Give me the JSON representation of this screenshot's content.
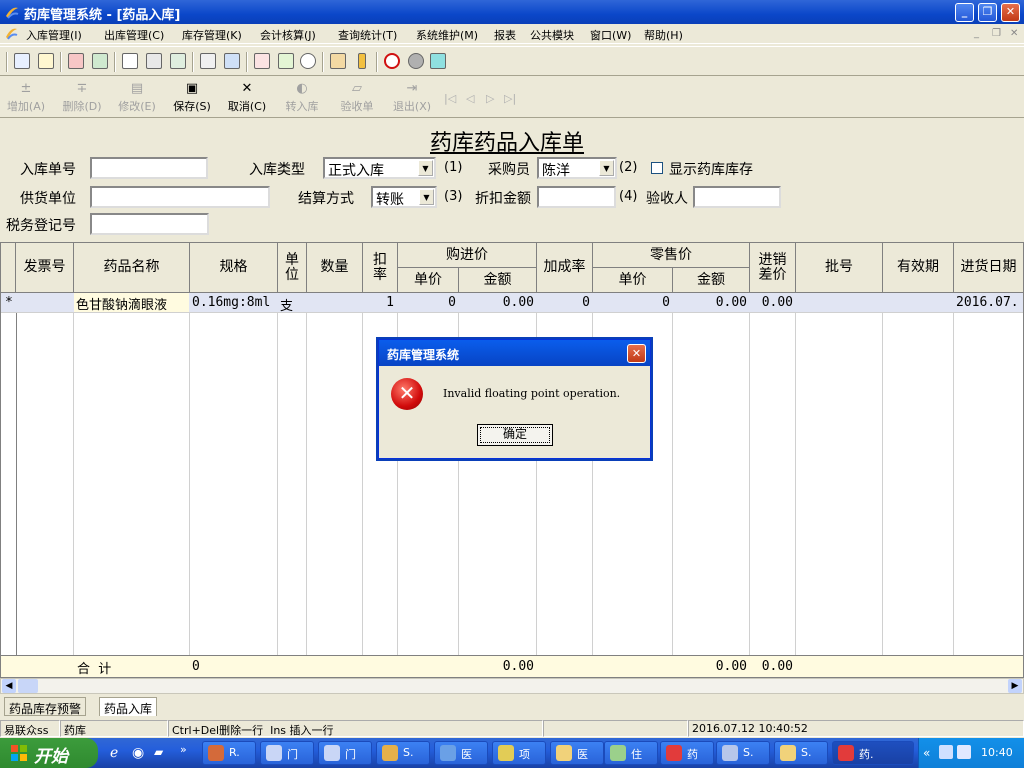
{
  "window": {
    "title": "药库管理系统 - [药品入库]"
  },
  "menu": {
    "items": [
      "入库管理(I)",
      "出库管理(C)",
      "库存管理(K)",
      "会计核算(J)",
      "查询统计(T)",
      "系统维护(M)",
      "报表",
      "公共模块",
      "窗口(W)",
      "帮助(H)"
    ]
  },
  "toolbar2": {
    "add": "增加(A)",
    "delete": "删除(D)",
    "modify": "修改(E)",
    "save": "保存(S)",
    "cancel": "取消(C)",
    "transfer": "转入库",
    "inspect": "验收单",
    "exit": "退出(X)"
  },
  "form": {
    "title": "药库药品入库单",
    "order_no_label": "入库单号",
    "order_no": "",
    "type_label": "入库类型",
    "type_value": "正式入库",
    "type_hint": "(1)",
    "buyer_label": "采购员",
    "buyer_value": "陈洋",
    "buyer_hint": "(2)",
    "show_stock_label": "显示药库库存",
    "supplier_label": "供货单位",
    "supplier": "",
    "settle_label": "结算方式",
    "settle_value": "转账",
    "settle_hint": "(3)",
    "discount_label": "折扣金额",
    "discount": "",
    "discount_hint": "(4)",
    "inspector_label": "验收人",
    "inspector": "",
    "tax_label": "税务登记号",
    "tax": ""
  },
  "grid": {
    "headers": {
      "invoice": "发票号",
      "name": "药品名称",
      "spec": "规格",
      "unit": "单位",
      "qty": "数量",
      "deduct": "扣率",
      "purchase": "购进价",
      "p_unit": "单价",
      "p_amount": "金额",
      "markup": "加成率",
      "retail": "零售价",
      "r_unit": "单价",
      "r_amount": "金额",
      "diff": "进销差价",
      "batch": "批号",
      "expiry": "有效期",
      "date": "进货日期"
    },
    "row": {
      "marker": "*",
      "invoice": "",
      "name": "色甘酸钠滴眼液",
      "spec": "0.16mg:8ml",
      "unit": "支",
      "qty": "",
      "deduct": "1",
      "p_unit": "0",
      "p_amount": "0.00",
      "markup": "0",
      "r_unit": "0",
      "r_amount": "0.00",
      "diff": "0.00",
      "batch": "",
      "expiry": "",
      "date": "2016.07."
    },
    "total": {
      "label": "合  计",
      "spec": "0",
      "p_amount": "0.00",
      "r_amount": "0.00",
      "diff": "0.00"
    }
  },
  "tabs": [
    "药品库存预警",
    "药品入库"
  ],
  "status": {
    "user": "易联众ss",
    "dept": "药库",
    "hint": "Ctrl+Del删除一行  Ins 插入一行",
    "datetime": "2016.07.12 10:40:52"
  },
  "dialog": {
    "title": "药库管理系统",
    "message": "Invalid floating point operation.",
    "ok": "确定"
  },
  "taskbar": {
    "start": "开始",
    "buttons": [
      "R.",
      "门",
      "门",
      "S.",
      "医",
      "项",
      "医",
      "住",
      "药",
      "S.",
      "S.",
      "药."
    ],
    "clock": "10:40"
  }
}
